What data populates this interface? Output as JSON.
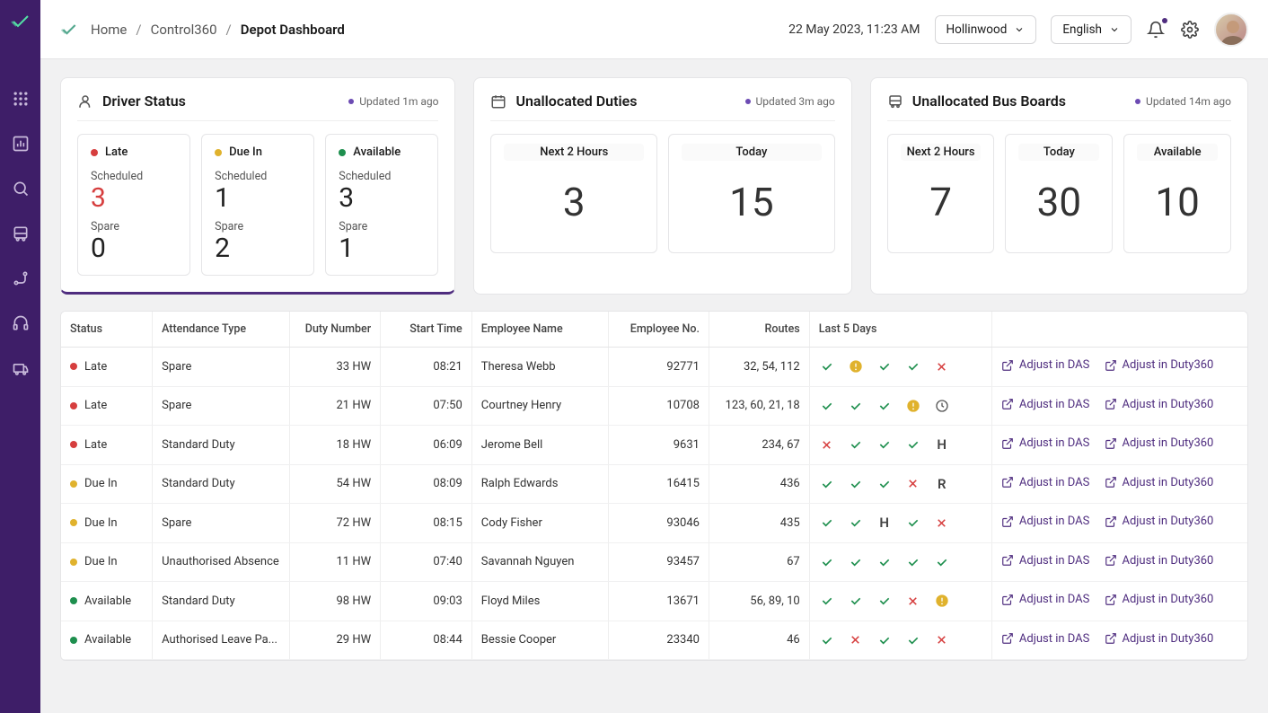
{
  "breadcrumb": {
    "home": "Home",
    "section": "Control360",
    "current": "Depot Dashboard"
  },
  "datetime": "22 May 2023, 11:23 AM",
  "depot_selector": "Hollinwood",
  "lang_selector": "English",
  "cards": {
    "driver_status": {
      "title": "Driver Status",
      "updated": "Updated 1m ago",
      "boxes": [
        {
          "label": "Late",
          "color": "red",
          "scheduled_label": "Scheduled",
          "scheduled": "3",
          "spare_label": "Spare",
          "spare": "0"
        },
        {
          "label": "Due In",
          "color": "yellow",
          "scheduled_label": "Scheduled",
          "scheduled": "1",
          "spare_label": "Spare",
          "spare": "2"
        },
        {
          "label": "Available",
          "color": "green",
          "scheduled_label": "Scheduled",
          "scheduled": "3",
          "spare_label": "Spare",
          "spare": "1"
        }
      ]
    },
    "unallocated_duties": {
      "title": "Unallocated Duties",
      "updated": "Updated 3m ago",
      "boxes": [
        {
          "label": "Next 2 Hours",
          "value": "3"
        },
        {
          "label": "Today",
          "value": "15"
        }
      ]
    },
    "unallocated_bus": {
      "title": "Unallocated Bus Boards",
      "updated": "Updated 14m ago",
      "boxes": [
        {
          "label": "Next 2 Hours",
          "value": "7"
        },
        {
          "label": "Today",
          "value": "30"
        },
        {
          "label": "Available",
          "value": "10"
        }
      ]
    }
  },
  "table": {
    "headers": {
      "status": "Status",
      "attendance": "Attendance Type",
      "duty": "Duty Number",
      "start": "Start Time",
      "name": "Employee Name",
      "empno": "Employee No.",
      "routes": "Routes",
      "last5": "Last 5 Days"
    },
    "actions": {
      "das": "Adjust in DAS",
      "d360": "Adjust in Duty360"
    },
    "rows": [
      {
        "status": "Late",
        "color": "red",
        "attendance": "Spare",
        "duty": "33 HW",
        "start": "08:21",
        "name": "Theresa Webb",
        "empno": "92771",
        "routes": "32, 54, 112",
        "days": [
          "check",
          "warn",
          "check",
          "check",
          "cross"
        ]
      },
      {
        "status": "Late",
        "color": "red",
        "attendance": "Spare",
        "duty": "21 HW",
        "start": "07:50",
        "name": "Courtney Henry",
        "empno": "10708",
        "routes": "123, 60, 21, 18",
        "days": [
          "check",
          "check",
          "check",
          "warn",
          "clock"
        ]
      },
      {
        "status": "Late",
        "color": "red",
        "attendance": "Standard Duty",
        "duty": "18 HW",
        "start": "06:09",
        "name": "Jerome Bell",
        "empno": "9631",
        "routes": "234, 67",
        "days": [
          "cross",
          "check",
          "check",
          "check",
          "H"
        ]
      },
      {
        "status": "Due In",
        "color": "yellow",
        "attendance": "Standard Duty",
        "duty": "54 HW",
        "start": "08:09",
        "name": "Ralph Edwards",
        "empno": "16415",
        "routes": "436",
        "days": [
          "check",
          "check",
          "check",
          "cross",
          "R"
        ]
      },
      {
        "status": "Due In",
        "color": "yellow",
        "attendance": "Spare",
        "duty": "72 HW",
        "start": "08:15",
        "name": "Cody Fisher",
        "empno": "93046",
        "routes": "435",
        "days": [
          "check",
          "check",
          "H",
          "check",
          "cross"
        ]
      },
      {
        "status": "Due In",
        "color": "yellow",
        "attendance": "Unauthorised Absence",
        "duty": "11 HW",
        "start": "07:40",
        "name": "Savannah Nguyen",
        "empno": "93457",
        "routes": "67",
        "days": [
          "check",
          "check",
          "check",
          "check",
          "check"
        ]
      },
      {
        "status": "Available",
        "color": "green",
        "attendance": "Standard Duty",
        "duty": "98 HW",
        "start": "09:03",
        "name": "Floyd Miles",
        "empno": "13671",
        "routes": "56, 89, 10",
        "days": [
          "check",
          "check",
          "check",
          "cross",
          "warn"
        ]
      },
      {
        "status": "Available",
        "color": "green",
        "attendance": "Authorised Leave Pa...",
        "duty": "29 HW",
        "start": "08:44",
        "name": "Bessie Cooper",
        "empno": "23340",
        "routes": "46",
        "days": [
          "check",
          "cross",
          "check",
          "check",
          "cross"
        ]
      }
    ]
  }
}
